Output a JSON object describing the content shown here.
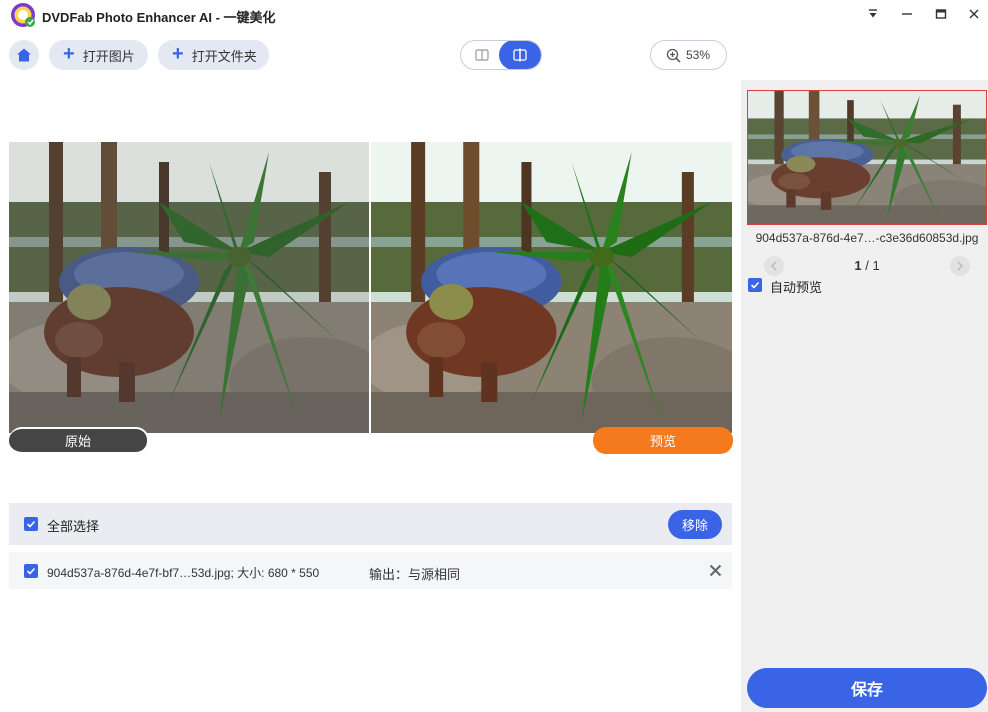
{
  "app": {
    "title": "DVDFab Photo Enhancer AI - 一键美化"
  },
  "toolbar": {
    "open_image_label": "打开图片",
    "open_folder_label": "打开文件夹",
    "zoom_level": "53%"
  },
  "preview": {
    "original_label": "原始",
    "preview_label": "预览"
  },
  "file_list": {
    "select_all_label": "全部选择",
    "select_all_checked": true,
    "remove_label": "移除",
    "rows": [
      {
        "checked": true,
        "file_info": "904d537a-876d-4e7f-bf7…53d.jpg; 大小: 680 * 550",
        "output_info": "输出：与源相同"
      }
    ]
  },
  "side_panel": {
    "thumbnail_name": "904d537a-876d-4e7…-c3e36d60853d.jpg",
    "page_current": "1",
    "page_separator": "/",
    "page_total": "1",
    "auto_preview_label": "自动预览",
    "auto_preview_checked": true,
    "save_label": "保存"
  },
  "colors": {
    "accent": "#3a64e6",
    "preview_tag": "#f47a1d",
    "original_tag": "#454545",
    "thumbnail_border": "#d54242"
  }
}
